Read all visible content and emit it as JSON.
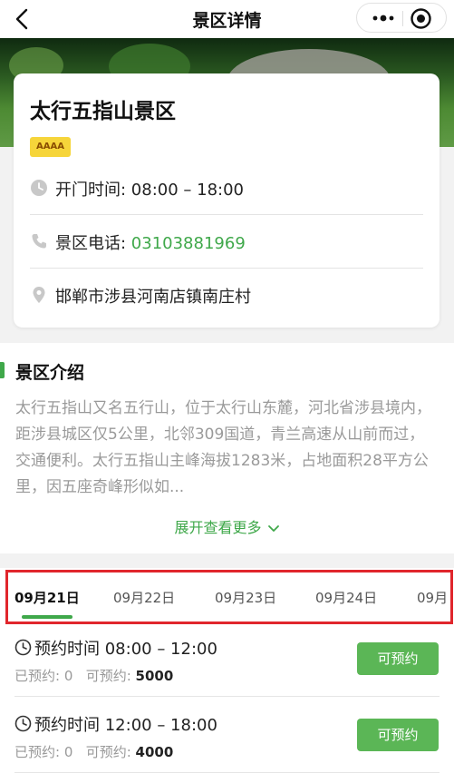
{
  "header": {
    "title": "景区详情"
  },
  "scenic": {
    "name": "太行五指山景区",
    "level": "AAAA",
    "hours_label": "开门时间: ",
    "hours": "08:00 – 18:00",
    "phone_label": "景区电话: ",
    "phone": "03103881969",
    "address": "邯郸市涉县河南店镇南庄村"
  },
  "intro": {
    "heading": "景区介绍",
    "text": "太行五指山又名五行山，位于太行山东麓，河北省涉县境内，距涉县城区仅5公里，北邻309国道，青兰高速从山前而过，交通便利。太行五指山主峰海拔1283米，占地面积28平方公里，因五座奇峰形似如...",
    "expand": "展开查看更多"
  },
  "dates": {
    "tabs": [
      {
        "label": "09月21日"
      },
      {
        "label": "09月22日"
      },
      {
        "label": "09月23日"
      },
      {
        "label": "09月24日"
      },
      {
        "label": "09月"
      }
    ]
  },
  "slots": [
    {
      "time": "预约时间 08:00 – 12:00",
      "booked_label": "已预约: ",
      "booked": "0",
      "avail_label": "可预约: ",
      "avail": "5000",
      "button": "可预约"
    },
    {
      "time": "预约时间 12:00 – 18:00",
      "booked_label": "已预约: ",
      "booked": "0",
      "avail_label": "可预约: ",
      "avail": "4000",
      "button": "可预约"
    }
  ],
  "colors": {
    "accent": "#3fa84a",
    "badge": "#f6d53a",
    "highlight": "#e0262c"
  },
  "icons": [
    "back-arrow-icon",
    "more-dots-icon",
    "target-icon",
    "clock-icon",
    "phone-icon",
    "location-pin-icon",
    "chevron-down-icon"
  ]
}
